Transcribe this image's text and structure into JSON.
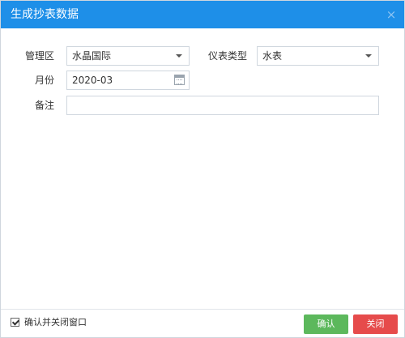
{
  "dialog": {
    "title": "生成抄表数据",
    "close_glyph": "×"
  },
  "form": {
    "area_label": "管理区",
    "area_value": "水晶国际",
    "meter_type_label": "仪表类型",
    "meter_type_value": "水表",
    "month_label": "月份",
    "month_value": "2020-03",
    "remark_label": "备注",
    "remark_value": ""
  },
  "footer": {
    "confirm_close_checkbox_label": "确认并关闭窗口",
    "confirm_close_checked": true,
    "confirm_button": "确认",
    "close_button": "关闭"
  },
  "colors": {
    "titlebar": "#1e8fe8",
    "confirm_button": "#5cb85c",
    "close_button": "#e64b4b"
  },
  "icons": {
    "month_picker": "calendar-icon",
    "select_caret": "caret-down-icon",
    "dialog_close": "close-icon"
  }
}
